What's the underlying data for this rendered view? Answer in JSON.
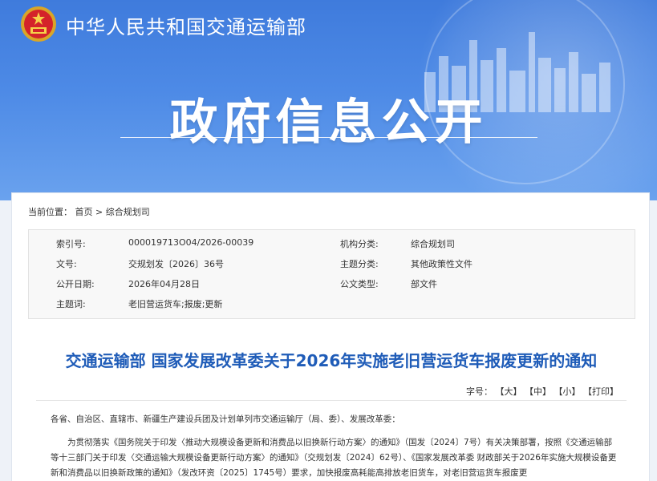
{
  "header": {
    "ministry_name": "中华人民共和国交通运输部",
    "banner_title": "政府信息公开"
  },
  "breadcrumb": {
    "label": "当前位置：",
    "home": "首页",
    "separator": ">",
    "current": "综合规划司"
  },
  "meta": {
    "rows": [
      {
        "label1": "索引号:",
        "value1": "000019713O04/2026-00039",
        "label2": "机构分类:",
        "value2": "综合规划司"
      },
      {
        "label1": "文号:",
        "value1": "交规划发〔2026〕36号",
        "label2": "主题分类:",
        "value2": "其他政策性文件"
      },
      {
        "label1": "公开日期:",
        "value1": "2026年04月28日",
        "label2": "公文类型:",
        "value2": "部文件"
      },
      {
        "label1": "主题词:",
        "value1": "老旧营运货车;报废;更新",
        "label2": "",
        "value2": ""
      }
    ]
  },
  "article": {
    "title": "交通运输部 国家发展改革委关于2026年实施老旧营运货车报废更新的通知",
    "font_size_label": "字号：",
    "font_large": "【大】",
    "font_medium": "【中】",
    "font_small": "【小】",
    "print": "【打印】",
    "salutation": "各省、自治区、直辖市、新疆生产建设兵团及计划单列市交通运输厅（局、委）、发展改革委：",
    "body": "为贯彻落实《国务院关于印发〈推动大规模设备更新和消费品以旧换新行动方案〉的通知》（国发〔2024〕7号）有关决策部署，按照《交通运输部等十三部门关于印发〈交通运输大规模设备更新行动方案〉的通知》（交规划发〔2024〕62号）、《国家发展改革委 财政部关于2026年实施大规模设备更新和消费品以旧换新政策的通知》（发改环资〔2025〕1745号）要求，加快报废高耗能高排放老旧货车，对老旧营运货车报废更"
  },
  "colors": {
    "banner": "#4d8ae6",
    "title_blue": "#1f5cb8"
  }
}
